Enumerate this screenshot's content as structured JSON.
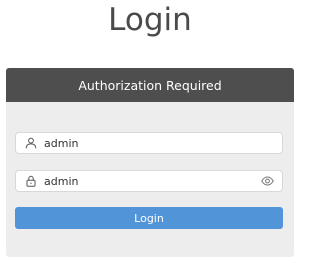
{
  "page": {
    "title": "Login"
  },
  "panel": {
    "header": "Authorization Required"
  },
  "form": {
    "username": {
      "value": "admin",
      "icon": "user-icon"
    },
    "password": {
      "value": "admin",
      "icon": "lock-icon",
      "toggle_icon": "eye-icon"
    },
    "submit_label": "Login"
  },
  "colors": {
    "header_bg": "#4e4e4e",
    "panel_bg": "#ededed",
    "button_bg": "#5294d8"
  }
}
